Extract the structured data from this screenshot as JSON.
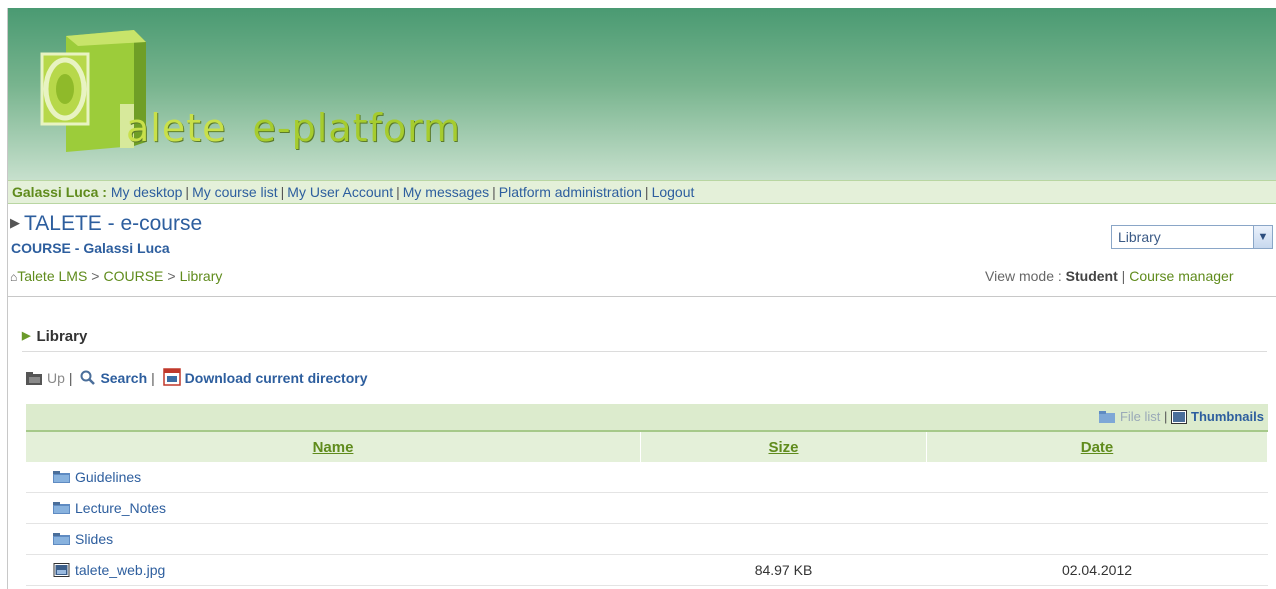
{
  "header": {
    "brand_talete": "alete",
    "brand_platform": "e-platform"
  },
  "topnav": {
    "user": "Galassi Luca :",
    "links": [
      "My desktop",
      "My course list",
      "My User Account",
      "My messages",
      "Platform administration",
      "Logout"
    ]
  },
  "course": {
    "title": "TALETE - e-course",
    "subtitle": "COURSE - Galassi Luca"
  },
  "tool_select": {
    "value": "Library"
  },
  "breadcrumb": {
    "items": [
      "Talete LMS",
      "COURSE",
      "Library"
    ]
  },
  "view_mode": {
    "label": "View mode :",
    "student": "Student",
    "manager": "Course manager"
  },
  "section": {
    "title": "Library"
  },
  "toolbar": {
    "up": "Up",
    "search": "Search",
    "download": "Download current directory"
  },
  "view_switch": {
    "file_list": "File list",
    "thumbnails": "Thumbnails"
  },
  "columns": {
    "name": "Name",
    "size": "Size",
    "date": "Date"
  },
  "rows": [
    {
      "name": "Guidelines",
      "size": "",
      "date": "",
      "icon": "folder-icon"
    },
    {
      "name": "Lecture_Notes",
      "size": "",
      "date": "",
      "icon": "folder-icon"
    },
    {
      "name": "Slides",
      "size": "",
      "date": "",
      "icon": "folder-icon"
    },
    {
      "name": "talete_web.jpg",
      "size": "84.97 KB",
      "date": "02.04.2012",
      "icon": "image-file-icon"
    }
  ],
  "colors": {
    "brand_green": "#5f8b1c",
    "link_blue": "#2d5e9e",
    "header_green": "#4a9a72"
  }
}
